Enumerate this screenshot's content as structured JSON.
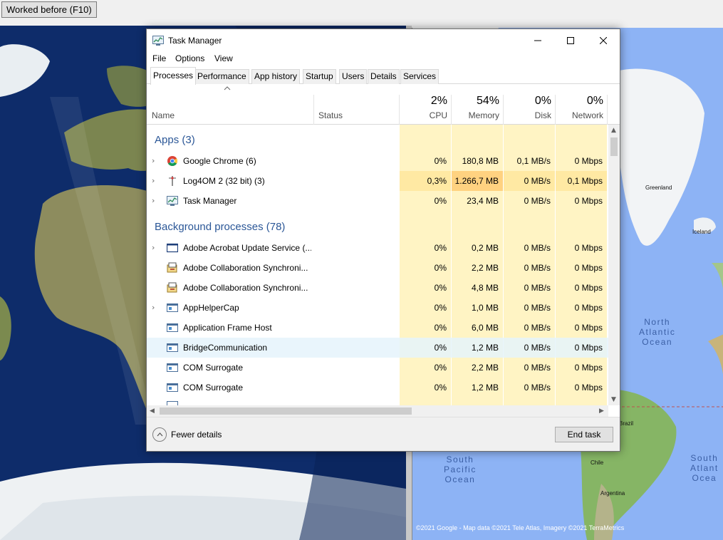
{
  "toolbar": {
    "worked_before_label": "Worked before (F10)"
  },
  "map": {
    "labels": {
      "greenland": "Greenland",
      "iceland": "Iceland",
      "brazil": "Brazil",
      "chile": "Chile",
      "argentina": "Argentina"
    },
    "oceans": {
      "north_atlantic": [
        "North",
        "Atlantic",
        "Ocean"
      ],
      "south_pacific": [
        "South",
        "Pacific",
        "Ocean"
      ],
      "south_atlantic": [
        "South",
        "Atlant",
        "Ocea"
      ]
    },
    "copyright": "©2021 Google - Map data ©2021 Tele Atlas, Imagery ©2021 TerraMetrics"
  },
  "task_manager": {
    "title": "Task Manager",
    "menu": [
      "File",
      "Options",
      "View"
    ],
    "tabs": [
      "Processes",
      "Performance",
      "App history",
      "Startup",
      "Users",
      "Details",
      "Services"
    ],
    "active_tab": "Processes",
    "columns": {
      "name": "Name",
      "status": "Status",
      "cpu": {
        "pct": "2%",
        "label": "CPU"
      },
      "memory": {
        "pct": "54%",
        "label": "Memory"
      },
      "disk": {
        "pct": "0%",
        "label": "Disk"
      },
      "network": {
        "pct": "0%",
        "label": "Network"
      }
    },
    "groups": {
      "apps": "Apps (3)",
      "background": "Background processes (78)"
    },
    "apps": [
      {
        "name": "Google Chrome (6)",
        "icon": "chrome-icon",
        "expandable": true,
        "cpu": "0%",
        "memory": "180,8 MB",
        "disk": "0,1 MB/s",
        "network": "0 Mbps"
      },
      {
        "name": "Log4OM 2 (32 bit) (3)",
        "icon": "log4om-icon",
        "expandable": true,
        "cpu": "0,3%",
        "memory": "1.266,7 MB",
        "disk": "0 MB/s",
        "network": "0,1 Mbps"
      },
      {
        "name": "Task Manager",
        "icon": "task-manager-icon",
        "expandable": true,
        "cpu": "0%",
        "memory": "23,4 MB",
        "disk": "0 MB/s",
        "network": "0 Mbps"
      }
    ],
    "background": [
      {
        "name": "Adobe Acrobat Update Service (...",
        "icon": "window-icon",
        "expandable": true,
        "cpu": "0%",
        "memory": "0,2 MB",
        "disk": "0 MB/s",
        "network": "0 Mbps"
      },
      {
        "name": "Adobe Collaboration Synchroni...",
        "icon": "adobe-sync-icon",
        "expandable": false,
        "cpu": "0%",
        "memory": "2,2 MB",
        "disk": "0 MB/s",
        "network": "0 Mbps"
      },
      {
        "name": "Adobe Collaboration Synchroni...",
        "icon": "adobe-sync-icon",
        "expandable": false,
        "cpu": "0%",
        "memory": "4,8 MB",
        "disk": "0 MB/s",
        "network": "0 Mbps"
      },
      {
        "name": "AppHelperCap",
        "icon": "app-icon",
        "expandable": true,
        "cpu": "0%",
        "memory": "1,0 MB",
        "disk": "0 MB/s",
        "network": "0 Mbps"
      },
      {
        "name": "Application Frame Host",
        "icon": "app-icon",
        "expandable": false,
        "cpu": "0%",
        "memory": "6,0 MB",
        "disk": "0 MB/s",
        "network": "0 Mbps"
      },
      {
        "name": "BridgeCommunication",
        "icon": "app-icon",
        "expandable": false,
        "selected": true,
        "cpu": "0%",
        "memory": "1,2 MB",
        "disk": "0 MB/s",
        "network": "0 Mbps"
      },
      {
        "name": "COM Surrogate",
        "icon": "app-icon",
        "expandable": false,
        "cpu": "0%",
        "memory": "2,2 MB",
        "disk": "0 MB/s",
        "network": "0 Mbps"
      },
      {
        "name": "COM Surrogate",
        "icon": "app-icon",
        "expandable": false,
        "cpu": "0%",
        "memory": "1,2 MB",
        "disk": "0 MB/s",
        "network": "0 Mbps"
      }
    ],
    "footer": {
      "fewer_details": "Fewer details",
      "end_task": "End task"
    }
  },
  "colors": {
    "heat_light": "#fff4c4",
    "heat_mid": "#ffe9a3",
    "heat_high": "#ffd280",
    "accent_blue": "#2b5797",
    "selection": "#e5f3fb"
  }
}
